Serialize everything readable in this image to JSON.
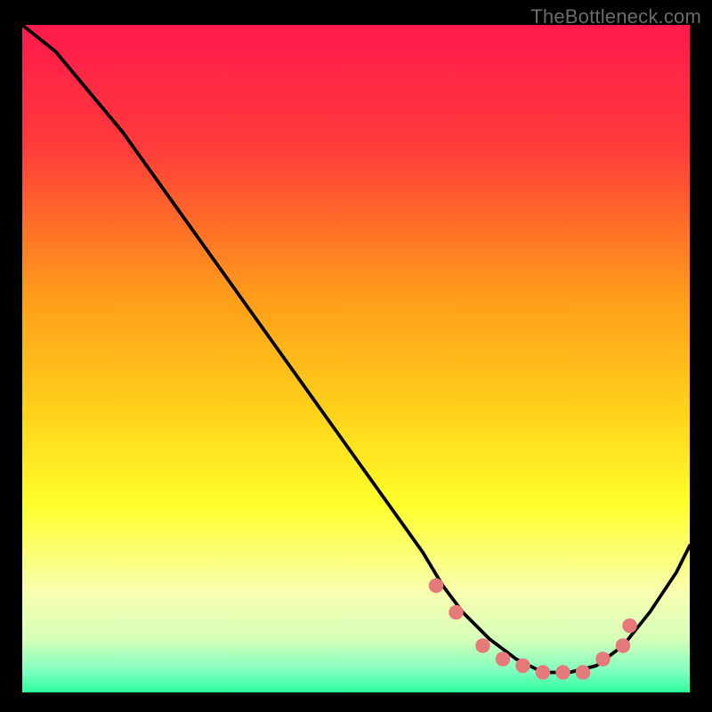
{
  "attribution": "TheBottleneck.com",
  "colors": {
    "background_black": "#000000",
    "gradient_stops": [
      {
        "offset": 0.0,
        "color": "#ff1a4d"
      },
      {
        "offset": 0.18,
        "color": "#ff3a3a"
      },
      {
        "offset": 0.4,
        "color": "#ff9a1a"
      },
      {
        "offset": 0.58,
        "color": "#ffd21a"
      },
      {
        "offset": 0.72,
        "color": "#ffff2a"
      },
      {
        "offset": 0.85,
        "color": "#f8ffb0"
      },
      {
        "offset": 0.92,
        "color": "#d6ffb8"
      },
      {
        "offset": 0.97,
        "color": "#7cffc0"
      },
      {
        "offset": 1.0,
        "color": "#2cff9a"
      }
    ],
    "curve_color": "#000000",
    "dot_color": "#e67a7a"
  },
  "chart_data": {
    "type": "line",
    "title": "",
    "xlabel": "",
    "ylabel": "",
    "xlim": [
      0,
      100
    ],
    "ylim": [
      0,
      100
    ],
    "series": [
      {
        "name": "bottleneck-curve",
        "x": [
          0,
          5,
          10,
          15,
          20,
          25,
          30,
          35,
          40,
          45,
          50,
          55,
          60,
          63,
          66,
          70,
          74,
          78,
          82,
          86,
          90,
          94,
          98,
          100
        ],
        "y": [
          100,
          96,
          90,
          84,
          77,
          70,
          63,
          56,
          49,
          42,
          35,
          28,
          21,
          16,
          12,
          8,
          5,
          3,
          3,
          4,
          7,
          12,
          18,
          22
        ]
      }
    ],
    "highlight_dots": {
      "name": "curve-dots",
      "x": [
        62,
        65,
        69,
        72,
        75,
        78,
        81,
        84,
        87,
        90,
        91
      ],
      "y": [
        16,
        12,
        7,
        5,
        4,
        3,
        3,
        3,
        5,
        7,
        10
      ]
    }
  }
}
